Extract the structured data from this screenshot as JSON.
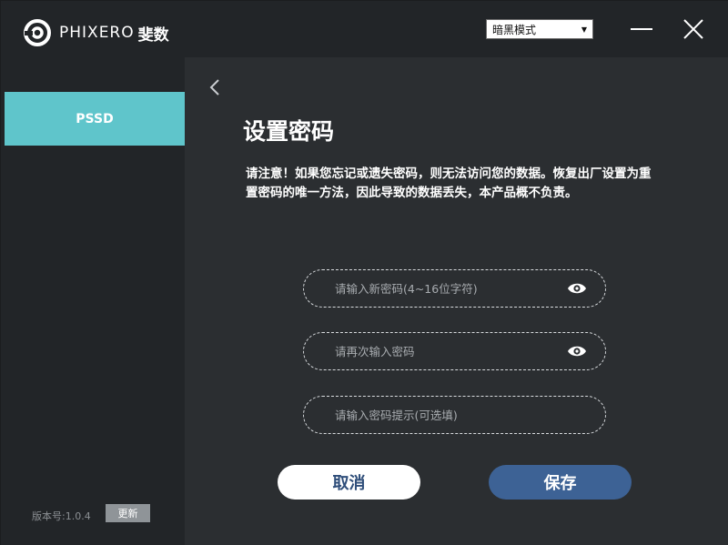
{
  "app": {
    "brand_text": "PHIXERO",
    "brand_cn": "斐数"
  },
  "header": {
    "theme_select_value": "暗黑模式",
    "icons": {
      "minimize": "minimize-icon",
      "close": "close-icon",
      "dropdown": "triangle-down-icon"
    }
  },
  "sidebar": {
    "items": [
      {
        "label": "PSSD",
        "active": true
      }
    ],
    "version_label": "版本号:1.0.4",
    "update_label": "更新"
  },
  "main": {
    "title": "设置密码",
    "notice": "请注意！如果您忘记或遗失密码，则无法访问您的数据。恢复出厂设置为重置密码的唯一方法，因此导致的数据丢失，本产品概不负责。",
    "fields": {
      "new_password": {
        "placeholder": "请输入新密码(4~16位字符)",
        "value": ""
      },
      "confirm_password": {
        "placeholder": "请再次输入密码",
        "value": ""
      },
      "hint": {
        "placeholder": "请输入密码提示(可选填)",
        "value": ""
      }
    },
    "cancel_label": "取消",
    "save_label": "保存"
  },
  "colors": {
    "accent": "#5fc5cb",
    "save_button": "#3d6295",
    "background": "#2b2e31",
    "panel": "#222528"
  }
}
